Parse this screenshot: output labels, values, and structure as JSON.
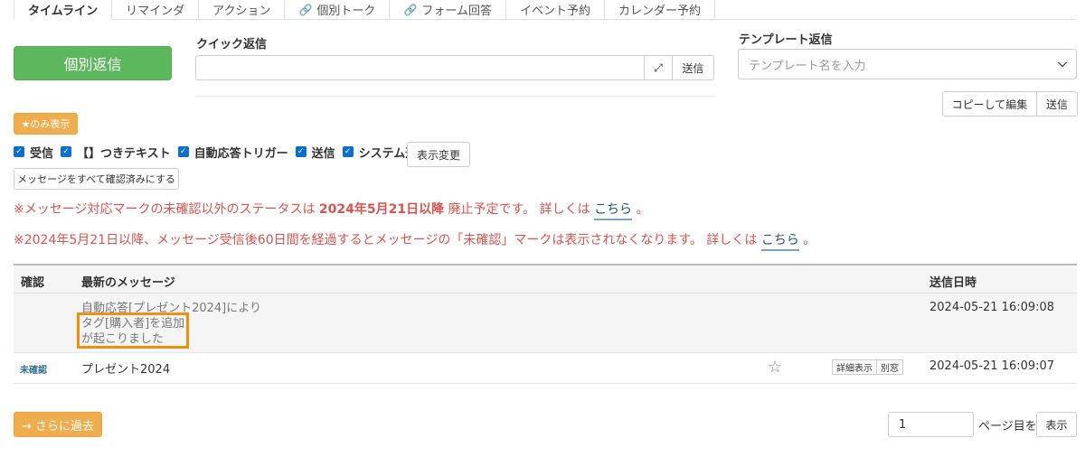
{
  "tabs": [
    {
      "label": "タイムライン",
      "active": true,
      "link": false
    },
    {
      "label": "リマインダ",
      "active": false,
      "link": false
    },
    {
      "label": "アクション",
      "active": false,
      "link": false
    },
    {
      "label": "個別トーク",
      "active": false,
      "link": true
    },
    {
      "label": "フォーム回答",
      "active": false,
      "link": true
    },
    {
      "label": "イベント予約",
      "active": false,
      "link": false
    },
    {
      "label": "カレンダー予約",
      "active": false,
      "link": false
    }
  ],
  "reply": {
    "individual_button": "個別返信",
    "quick_label": "クイック返信",
    "quick_value": "",
    "expand_icon": "⤢",
    "send_label": "送信"
  },
  "template": {
    "label": "テンプレート返信",
    "placeholder": "テンプレート名を入力",
    "copy_edit_label": "コピーして編集",
    "send_label": "送信"
  },
  "filters": {
    "star_only_label": "★のみ表示",
    "checkboxes": [
      "受信",
      "【】つきテキスト",
      "自動応答トリガー",
      "送信",
      "システム通知"
    ],
    "display_change_label": "表示変更",
    "confirm_all_label": "メッセージをすべて確認済みにする"
  },
  "notices": {
    "n1_pre": "※メッセージ対応マークの未確認以外のステータスは ",
    "n1_date": "2024年5月21日以降",
    "n1_post": " 廃止予定です。 詳しくは ",
    "n1_link": "こちら",
    "n1_end": " 。",
    "n2_pre": "※2024年5月21日以降、メッセージ受信後60日間を経過するとメッセージの「未確認」マークは表示されなくなります。 詳しくは ",
    "n2_link": "こちら",
    "n2_end": " 。"
  },
  "table": {
    "headers": {
      "confirm": "確認",
      "message": "最新のメッセージ",
      "sent_at": "送信日時"
    },
    "rows": [
      {
        "status": "",
        "message_lines": [
          "自動応答[プレゼント2024]により",
          "タグ[購入者]を追加",
          "が起こりました"
        ],
        "sent_at": "2024-05-21 16:09:08"
      },
      {
        "status": "未確認",
        "message": "プレゼント2024",
        "star_icon": "☆",
        "detail_label": "詳細表示",
        "window_label": "別窓",
        "sent_at": "2024-05-21 16:09:07"
      }
    ]
  },
  "footer": {
    "older_label": "→ さらに過去",
    "page_value": "1",
    "page_label": "ページ目を",
    "show_label": "表示"
  },
  "colors": {
    "green_button": "#5cb85c",
    "orange_button": "#f0ad4e",
    "notice_red": "#d9534f",
    "checkbox_blue": "#0b6fd0",
    "highlight_orange": "#f0900f"
  }
}
